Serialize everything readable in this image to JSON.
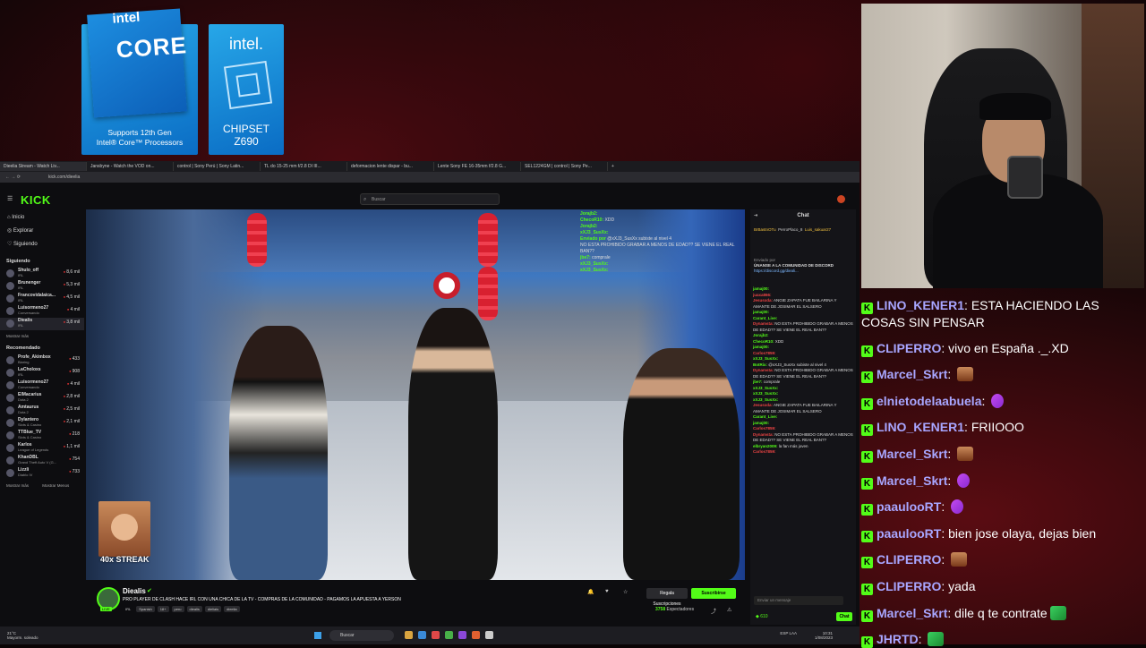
{
  "intel": {
    "core_logo": "intel",
    "core_big": "CORE",
    "core_sub1": "Supports 12th Gen",
    "core_sub2": "Intel® Core™ Processors",
    "chip_logo": "intel.",
    "chip_sub1": "CHIPSET",
    "chip_sub2": "Z690"
  },
  "browser": {
    "tabs": [
      "Dieelia Stream - Watch Liv...",
      "Jansbyne - Watch the VOD on...",
      "control | Sony Perú | Sony Latin...",
      "TL do 15-25 mm f/2.8 DI III...",
      "deformacion lente dispar - bu...",
      "Lente Sony FE 16-35mm f/2.8 G...",
      "SEL1224GM | control | Sony Pe..."
    ],
    "url": "kick.com/dieelia"
  },
  "kick": {
    "logo": "KICK",
    "search_placeholder": "Buscar",
    "nav": [
      "Inicio",
      "Explorar",
      "Siguiendo"
    ],
    "following_title": "Siguiendo",
    "following": [
      {
        "name": "Shulo_off",
        "cat": "IRL",
        "viewers": "8,6 mil"
      },
      {
        "name": "Brunenger",
        "cat": "IRL",
        "viewers": "5,3 mil"
      },
      {
        "name": "Francovidalaica...",
        "cat": "IRL",
        "viewers": "4,5 mil"
      },
      {
        "name": "Luisormeno27",
        "cat": "Conversando",
        "viewers": "4 mil"
      },
      {
        "name": "Diealis",
        "cat": "IRL",
        "viewers": "3,8 mil"
      }
    ],
    "show_more": "Mostrar más",
    "recommended_title": "Recomendado",
    "recommended": [
      {
        "name": "Profe_Akimbox",
        "cat": "Blaring",
        "viewers": "433"
      },
      {
        "name": "LaCholoxs",
        "cat": "IRL",
        "viewers": "908"
      },
      {
        "name": "Luisormeno27",
        "cat": "Conversando",
        "viewers": "4 mil"
      },
      {
        "name": "ElMacarius",
        "cat": "Dota 2",
        "viewers": "2,8 mil"
      },
      {
        "name": "Amtaurus",
        "cat": "Dota 2",
        "viewers": "2,5 mil"
      },
      {
        "name": "Dylantero",
        "cat": "Slots & Casino",
        "viewers": "2,1 mil"
      },
      {
        "name": "TTBlue_TV",
        "cat": "Slots & Casino",
        "viewers": "218"
      },
      {
        "name": "Karlos",
        "cat": "League of Legends",
        "viewers": "1,1 mil"
      },
      {
        "name": "KhanDBL",
        "cat": "Grand Theft Auto V (G...",
        "viewers": "754"
      },
      {
        "name": "Lizzli",
        "cat": "Diablo IV",
        "viewers": "733"
      }
    ],
    "show_more_2": "Mostrar más",
    "show_less": "Mostrar Menos"
  },
  "video": {
    "overlay_chat": [
      {
        "u": "Jorajb2:",
        "t": ""
      },
      {
        "u": "ChecoR10:",
        "t": "XDD"
      },
      {
        "u": "Jorajb2:",
        "t": ""
      },
      {
        "u": "xXJ3_SusXx:",
        "t": ""
      },
      {
        "u": "Enviado por",
        "t": "@xXJ3_SusXx subiste al nivel 4"
      },
      {
        "u": "",
        "t": "NO ESTA PROHIBIDO GRABAR A MENOS DE EDAD?? SE VIENE EL REAL BAN??"
      },
      {
        "u": "jbe7:",
        "t": "comprale"
      },
      {
        "u": "xXJ3_SusXx:",
        "t": ""
      },
      {
        "u": "xXJ3_SusXx:",
        "t": ""
      }
    ],
    "emote_label": "40x STREAK"
  },
  "channel": {
    "name": "Diealis",
    "title": "PRO PLAYER DE CLASH HACE IRL CON UNA CHICA DE LA TV - COMPRAS DE LA COMUNIDAD - PAGAMOS LA APUESTA A YERSON",
    "live": "LIVE",
    "tags": [
      "IRL",
      "Spanish",
      "18+",
      "peru",
      "diealis",
      "dieliais",
      "dieelia"
    ],
    "gift_label": "Regala Suscripciones",
    "sub_label": "Suscribirse",
    "viewers": "3758",
    "viewers_label": "Espectadores"
  },
  "kchat": {
    "title": "Chat",
    "pinned_by": "Enviado por",
    "pinned_text": "ÚNANSE A LA COMUNIDAD DE DISCORD",
    "pinned_link": "https://discord.gg/dieali...",
    "top_users": [
      "BrBastnOTu",
      "PerroPlaco_8",
      "Luis_sakuar27"
    ],
    "lines": [
      {
        "u": "jamaj00:",
        "t": ""
      },
      {
        "u": "juaxa866:",
        "t": ""
      },
      {
        "u": "Jesusxda:",
        "t": "ANGIE ZAPATA FUE BAILARINA Y AMANTE DE JOSIMAR EL SALSERO"
      },
      {
        "u": "jamaj00:",
        "t": ""
      },
      {
        "u": "Carant_Live:",
        "t": ""
      },
      {
        "u": "Dynamsta:",
        "t": "NO ESTA PROHIBIDO GRABAR A MENOS DE EDAD?? SE VIENE EL REAL BAN??"
      },
      {
        "u": "Jorajb2:",
        "t": ""
      },
      {
        "u": "ChecoR10:",
        "t": "XDD"
      },
      {
        "u": "jamaj00:",
        "t": ""
      },
      {
        "u": "Carlos7859:",
        "t": ""
      },
      {
        "u": "xXJ3_SusXx:",
        "t": ""
      },
      {
        "u": "BotRix:",
        "t": "@xXJ3_SusXx subiste al nivel 4"
      },
      {
        "u": "Dynamsta:",
        "t": "NO ESTA PROHIBIDO GRABAR A MENOS DE EDAD?? SE VIENE EL REAL BAN??"
      },
      {
        "u": "jbe7:",
        "t": "comprale"
      },
      {
        "u": "xXJ3_SusXx:",
        "t": ""
      },
      {
        "u": "xXJ3_SusXx:",
        "t": ""
      },
      {
        "u": "xXJ3_SusXx:",
        "t": ""
      },
      {
        "u": "Jesusxda:",
        "t": "ANGIE ZAPATA FUE BAILARINA Y AMANTE DE JOSIMAR EL SALSERO"
      },
      {
        "u": "Carant_Live:",
        "t": ""
      },
      {
        "u": "jamaj00:",
        "t": ""
      },
      {
        "u": "Carlos7859:",
        "t": ""
      },
      {
        "u": "Dynamsta:",
        "t": "NO ESTA PROHIBIDO GRABAR A MENOS DE EDAD?? SE VIENE EL REAL BAN??"
      },
      {
        "u": "elbryan2009:",
        "t": "la fan más joven"
      },
      {
        "u": "Carlos7859:",
        "t": ""
      }
    ],
    "input_placeholder": "Enviar un mensaje",
    "count": "610",
    "chat_btn": "Chat"
  },
  "taskbar": {
    "temp": "21°C",
    "weather": "Mayorm. soleado",
    "search": "Buscar",
    "lang": "ESP LAA",
    "time": "10:31",
    "date": "1/08/2023"
  },
  "bigchat": [
    {
      "u": "LINO_KENER1",
      "t": "ESTA HACIENDO LAS COSAS SIN PENSAR",
      "emote": ""
    },
    {
      "u": "CLIPERRO",
      "t": "vivo en España ._.XD",
      "emote": ""
    },
    {
      "u": "Marcel_Skrt",
      "t": "",
      "emote": "face"
    },
    {
      "u": "elnietodelaabuela",
      "t": "",
      "emote": "pink"
    },
    {
      "u": "LINO_KENER1",
      "t": "FRIIOOO",
      "emote": ""
    },
    {
      "u": "Marcel_Skrt",
      "t": "",
      "emote": "face"
    },
    {
      "u": "Marcel_Skrt",
      "t": "",
      "emote": "pink"
    },
    {
      "u": "paaulooRT",
      "t": "",
      "emote": "pink"
    },
    {
      "u": "paaulooRT",
      "t": "bien jose olaya, dejas bien",
      "emote": ""
    },
    {
      "u": "CLIPERRO",
      "t": "",
      "emote": "face"
    },
    {
      "u": "CLIPERRO",
      "t": "yada",
      "emote": ""
    },
    {
      "u": "Marcel_Skrt",
      "t": "dile q te contrate",
      "emote": "green"
    },
    {
      "u": "JHRTD",
      "t": "",
      "emote": "green"
    }
  ]
}
